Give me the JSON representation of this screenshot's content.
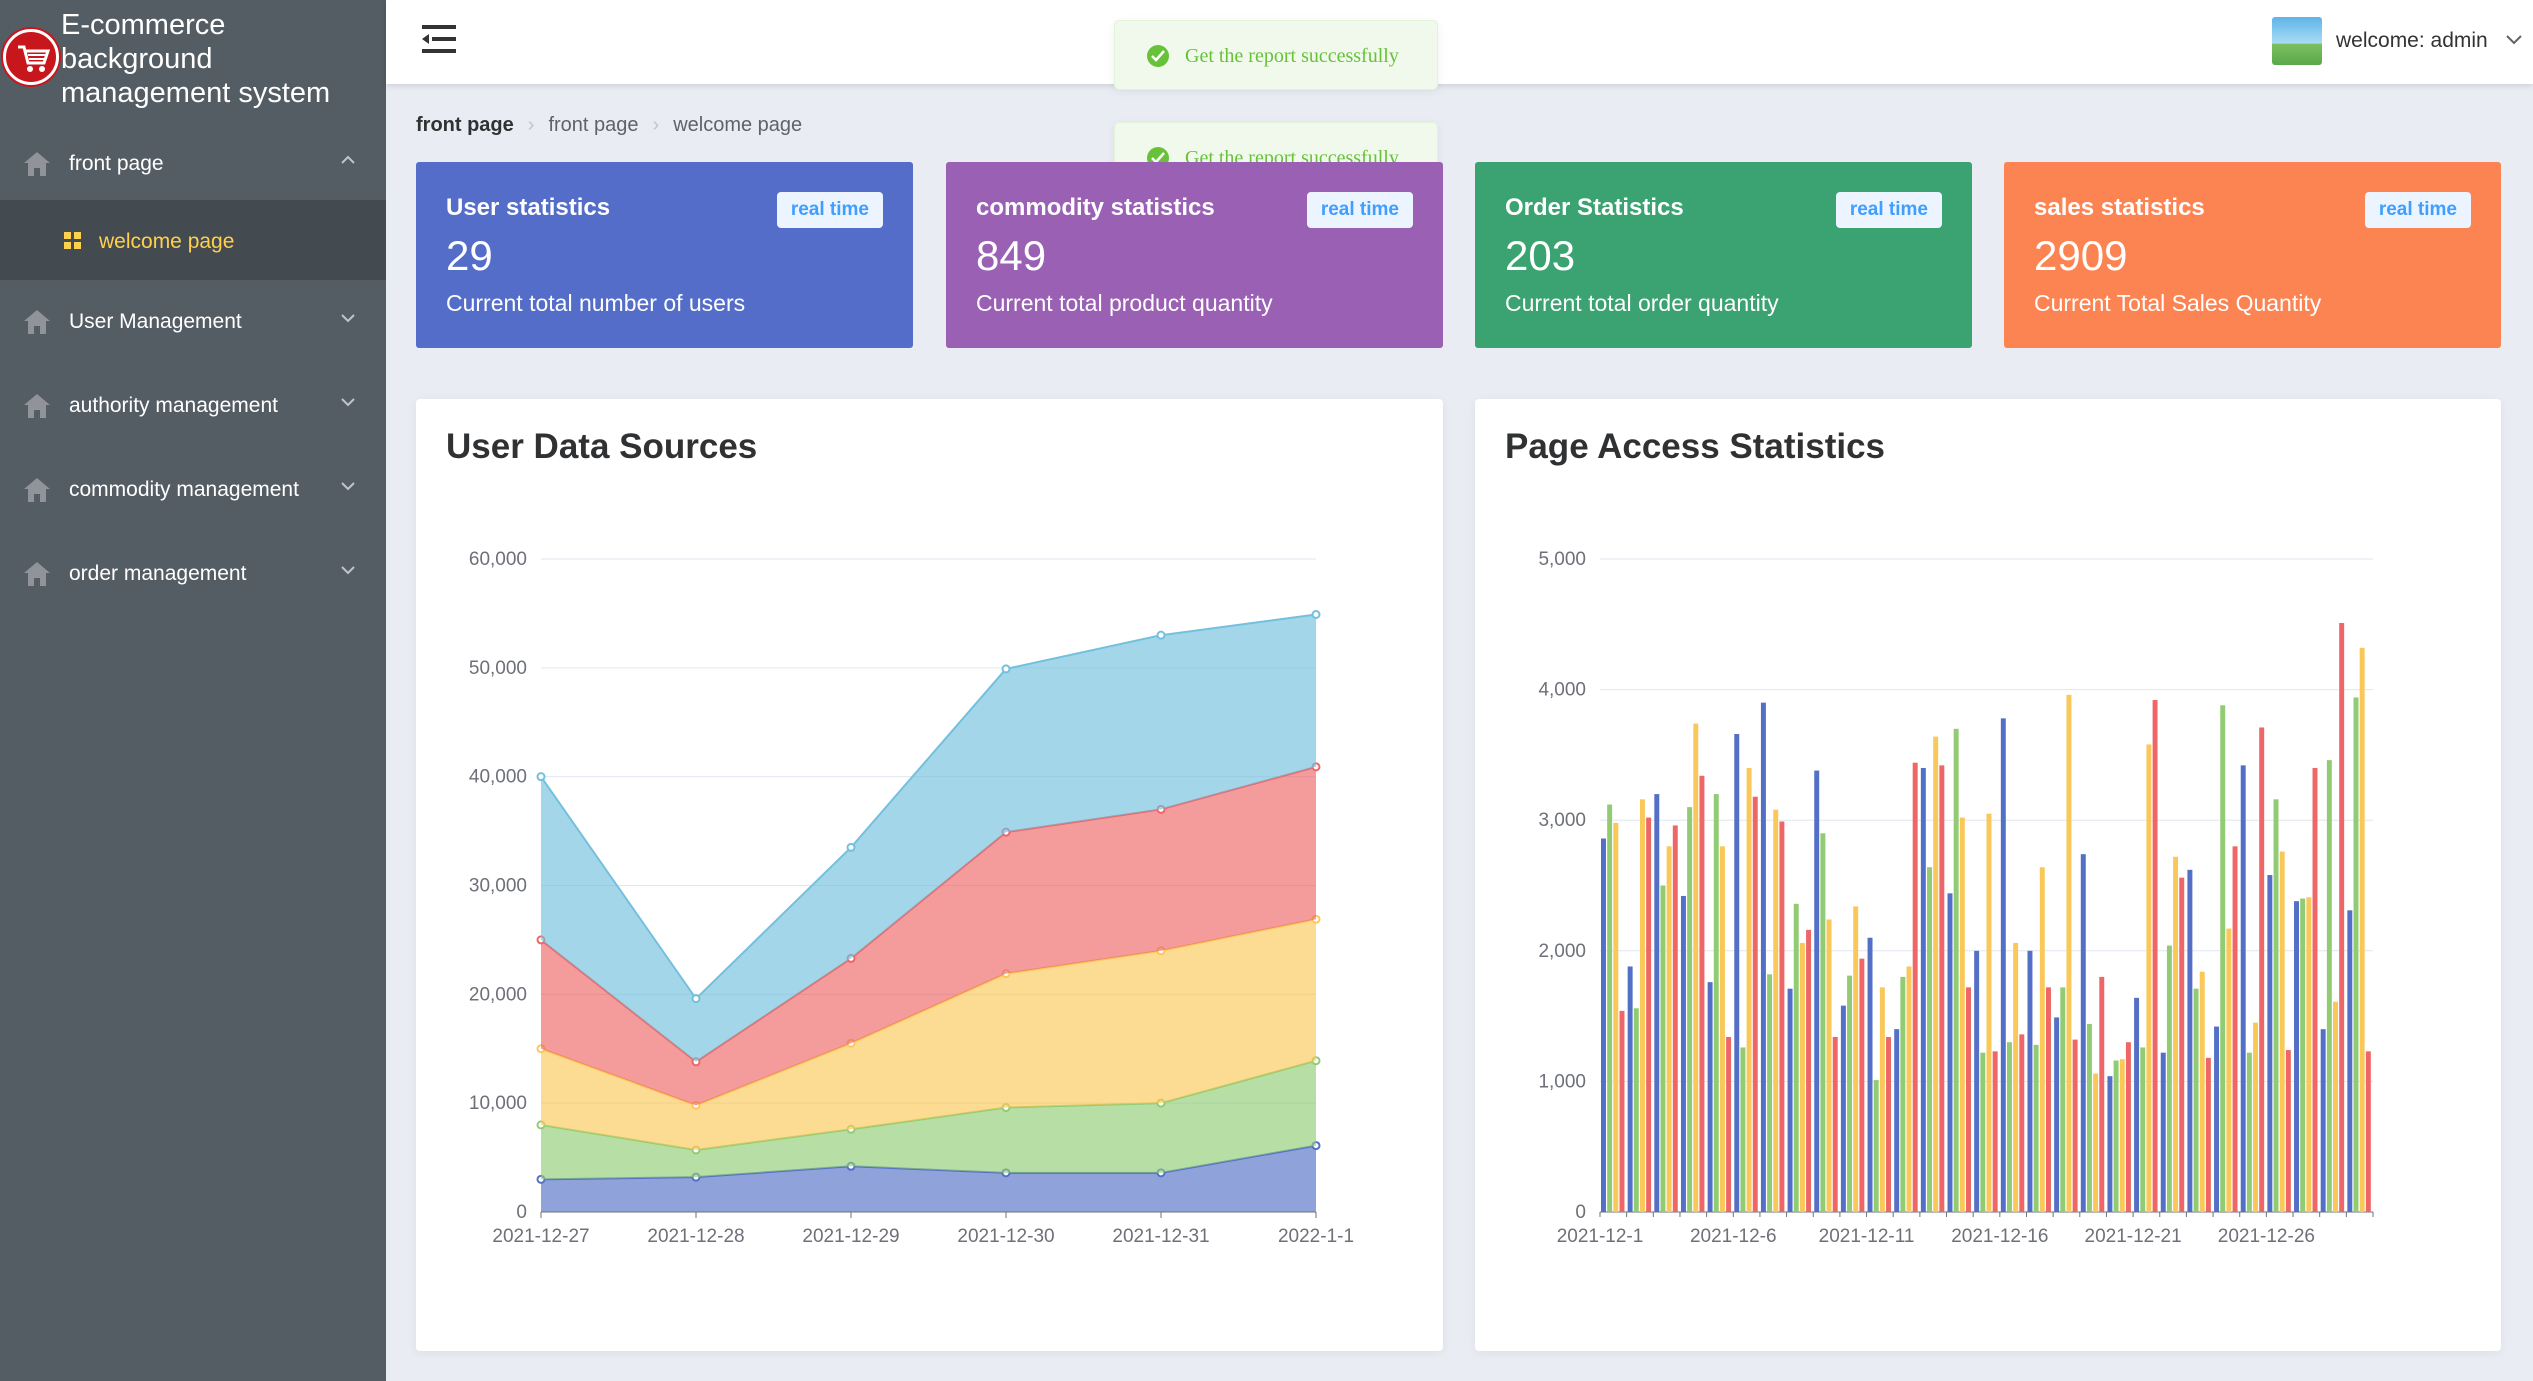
{
  "app": {
    "title": "E-commerce background management system"
  },
  "sidebar": {
    "items": [
      {
        "label": "front page",
        "icon": "home-icon",
        "expanded": true
      },
      {
        "label": "User Management",
        "icon": "home-icon",
        "expanded": false
      },
      {
        "label": "authority management",
        "icon": "home-icon",
        "expanded": false
      },
      {
        "label": "commodity management",
        "icon": "home-icon",
        "expanded": false
      },
      {
        "label": "order management",
        "icon": "home-icon",
        "expanded": false
      }
    ],
    "submenu": {
      "label": "welcome page",
      "icon": "grid-icon",
      "active_color": "#ffd04b"
    }
  },
  "header": {
    "welcome_text": "welcome: admin"
  },
  "toasts": [
    {
      "message": "Get the report successfully"
    },
    {
      "message": "Get the report successfully"
    }
  ],
  "breadcrumb": {
    "items": [
      "front page",
      "welcome page"
    ],
    "current": "front page"
  },
  "cards": [
    {
      "title": "User statistics",
      "tag": "real time",
      "value": "29",
      "desc": "Current total number of users",
      "color": "#536dc9"
    },
    {
      "title": "commodity statistics",
      "tag": "real time",
      "value": "849",
      "desc": "Current total product quantity",
      "color": "#9a60b4"
    },
    {
      "title": "Order Statistics",
      "tag": "real time",
      "value": "203",
      "desc": "Current total order quantity",
      "color": "#3ba272"
    },
    {
      "title": "sales statistics",
      "tag": "real time",
      "value": "2909",
      "desc": "Current Total Sales Quantity",
      "color": "#fc8452"
    }
  ],
  "panels": {
    "left_title": "User Data Sources",
    "right_title": "Page Access Statistics"
  },
  "chart_data": [
    {
      "type": "area",
      "title": "User Data Sources",
      "stacked": true,
      "x": [
        "2021-12-27",
        "2021-12-28",
        "2021-12-29",
        "2021-12-30",
        "2021-12-31",
        "2022-1-1"
      ],
      "ylim": [
        0,
        60000
      ],
      "yticks": [
        0,
        10000,
        20000,
        30000,
        40000,
        50000,
        60000
      ],
      "ytick_labels": [
        "0",
        "10,000",
        "20,000",
        "30,000",
        "40,000",
        "50,000",
        "60,000"
      ],
      "grid": true,
      "series": [
        {
          "values": [
            3000,
            3200,
            4200,
            3600,
            3600,
            6100
          ],
          "color": "#5470c6"
        },
        {
          "values": [
            5000,
            2500,
            3400,
            6000,
            6400,
            7800
          ],
          "color": "#91cc75"
        },
        {
          "values": [
            7000,
            4100,
            7900,
            12300,
            14000,
            13000
          ],
          "color": "#fac858"
        },
        {
          "values": [
            10000,
            4000,
            7800,
            13000,
            13000,
            14000
          ],
          "color": "#ee6666"
        },
        {
          "values": [
            15000,
            5800,
            10200,
            15000,
            16000,
            14000
          ],
          "color": "#73c0de"
        }
      ]
    },
    {
      "type": "bar",
      "title": "Page Access Statistics",
      "ylim": [
        0,
        5000
      ],
      "yticks": [
        0,
        1000,
        2000,
        3000,
        4000,
        5000
      ],
      "ytick_labels": [
        "0",
        "1,000",
        "2,000",
        "3,000",
        "4,000",
        "5,000"
      ],
      "grid": true,
      "categories": [
        "2021-12-1",
        "2021-12-2",
        "2021-12-3",
        "2021-12-4",
        "2021-12-5",
        "2021-12-6",
        "2021-12-7",
        "2021-12-8",
        "2021-12-9",
        "2021-12-10",
        "2021-12-11",
        "2021-12-12",
        "2021-12-13",
        "2021-12-14",
        "2021-12-15",
        "2021-12-16",
        "2021-12-17",
        "2021-12-18",
        "2021-12-19",
        "2021-12-20",
        "2021-12-21",
        "2021-12-22",
        "2021-12-23",
        "2021-12-24",
        "2021-12-25",
        "2021-12-26",
        "2021-12-27",
        "2021-12-28",
        "2021-12-29"
      ],
      "xtick_labels": [
        "2021-12-1",
        "2021-12-6",
        "2021-12-11",
        "2021-12-16",
        "2021-12-21",
        "2021-12-26"
      ],
      "xtick_indices": [
        0,
        5,
        10,
        15,
        20,
        25
      ],
      "series": [
        {
          "color": "#5470c6",
          "values": [
            2860,
            1880,
            3200,
            2420,
            1760,
            3660,
            3900,
            1710,
            3380,
            1580,
            2100,
            1400,
            3400,
            2440,
            2000,
            3780,
            2000,
            1490,
            2740,
            1040,
            1640,
            1220,
            2620,
            1420,
            3420,
            2580,
            2380,
            1400,
            2310
          ]
        },
        {
          "color": "#91cc75",
          "values": [
            3120,
            1560,
            2500,
            3100,
            3200,
            1260,
            1820,
            2360,
            2900,
            1810,
            1010,
            1800,
            2640,
            3700,
            1220,
            1300,
            1280,
            1720,
            1440,
            1160,
            1260,
            2040,
            1710,
            3880,
            1220,
            3160,
            2400,
            3460,
            3940
          ]
        },
        {
          "color": "#fac858",
          "values": [
            2980,
            3160,
            2800,
            3740,
            2800,
            3400,
            3080,
            2060,
            2240,
            2340,
            1720,
            1880,
            3640,
            3020,
            3050,
            2060,
            2640,
            3960,
            1060,
            1170,
            3580,
            2720,
            1840,
            2170,
            1450,
            2760,
            2410,
            1610,
            4320
          ]
        },
        {
          "color": "#ee6666",
          "values": [
            1540,
            3020,
            2960,
            3340,
            1340,
            3180,
            2990,
            2160,
            1340,
            1940,
            1340,
            3440,
            3420,
            1720,
            1230,
            1360,
            1720,
            1320,
            1800,
            1300,
            3920,
            2560,
            1180,
            2800,
            3710,
            1240,
            3400,
            4510,
            1230
          ]
        }
      ]
    }
  ]
}
